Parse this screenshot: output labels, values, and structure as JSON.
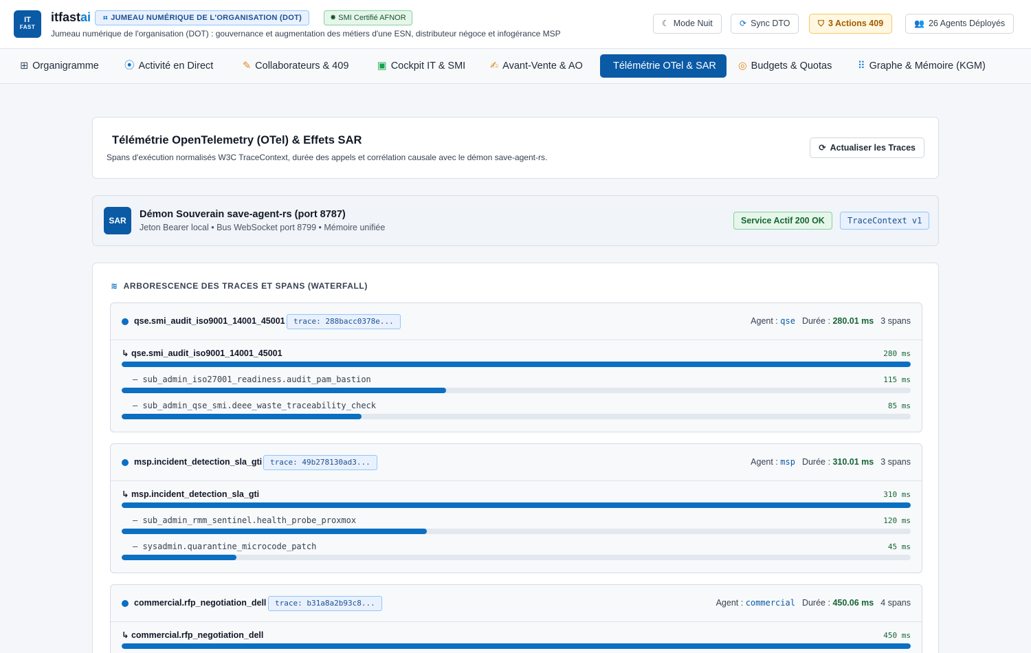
{
  "header": {
    "logo_top": "IT",
    "logo_bottom": "FAST",
    "brand": "itfast",
    "brand_suffix": "ai",
    "badge_dot": "JUMEAU NUMÉRIQUE DE L'ORGANISATION (DOT)",
    "badge_smi": "SMI Certifié AFNOR",
    "subtitle": "Jumeau numérique de l'organisation (DOT) : gouvernance et augmentation des métiers d'une ESN, distributeur négoce et infogérance MSP",
    "buttons": {
      "night": "Mode Nuit",
      "sync": "Sync DTO",
      "actions": "3 Actions 409",
      "agents": "26 Agents Déployés"
    }
  },
  "tabs": [
    {
      "label": "Organigramme",
      "icon": "sitemap-icon"
    },
    {
      "label": "Activité en Direct",
      "icon": "broadcast-icon"
    },
    {
      "label": "Collaborateurs & 409",
      "icon": "user-edit-icon"
    },
    {
      "label": "Cockpit IT & SMI",
      "icon": "briefcase-icon"
    },
    {
      "label": "Avant-Vente & AO",
      "icon": "file-signature-icon"
    },
    {
      "label": "Télémétrie OTel & SAR",
      "icon": "telemetry-icon",
      "active": true
    },
    {
      "label": "Budgets & Quotas",
      "icon": "coins-icon"
    },
    {
      "label": "Graphe & Mémoire (KGM)",
      "icon": "graph-icon"
    }
  ],
  "telemetry": {
    "title": "Télémétrie OpenTelemetry (OTel) & Effets SAR",
    "description": "Spans d'exécution normalisés W3C TraceContext, durée des appels et corrélation causale avec le démon save-agent-rs.",
    "refresh_label": "Actualiser les Traces"
  },
  "sar": {
    "logo": "SAR",
    "title": "Démon Souverain save-agent-rs (port 8787)",
    "subtitle": "Jeton Bearer local • Bus WebSocket port 8799 • Mémoire unifiée",
    "status": "Service Actif 200 OK",
    "trace_context": "TraceContext v1"
  },
  "waterfall": {
    "heading": "ARBORESCENCE DES TRACES ET SPANS (WATERFALL)",
    "agent_label": "Agent :",
    "duration_label": "Durée :",
    "traces": [
      {
        "name": "qse.smi_audit_iso9001_14001_45001",
        "trace_id": "trace: 288bacc0378e...",
        "agent": "qse",
        "duration": "280.01 ms",
        "spans_count": "3 spans",
        "total_ms": 280,
        "spans": [
          {
            "label": "↳ qse.smi_audit_iso9001_14001_45001",
            "ms": 280,
            "ms_label": "280 ms",
            "root": true
          },
          {
            "label": "– sub_admin_iso27001_readiness.audit_pam_bastion",
            "ms": 115,
            "ms_label": "115 ms"
          },
          {
            "label": "– sub_admin_qse_smi.deee_waste_traceability_check",
            "ms": 85,
            "ms_label": "85 ms"
          }
        ]
      },
      {
        "name": "msp.incident_detection_sla_gti",
        "trace_id": "trace: 49b278130ad3...",
        "agent": "msp",
        "duration": "310.01 ms",
        "spans_count": "3 spans",
        "total_ms": 310,
        "spans": [
          {
            "label": "↳ msp.incident_detection_sla_gti",
            "ms": 310,
            "ms_label": "310 ms",
            "root": true
          },
          {
            "label": "– sub_admin_rmm_sentinel.health_probe_proxmox",
            "ms": 120,
            "ms_label": "120 ms"
          },
          {
            "label": "– sysadmin.quarantine_microcode_patch",
            "ms": 45,
            "ms_label": "45 ms"
          }
        ]
      },
      {
        "name": "commercial.rfp_negotiation_dell",
        "trace_id": "trace: b31a8a2b93c8...",
        "agent": "commercial",
        "duration": "450.06 ms",
        "spans_count": "4 spans",
        "total_ms": 450,
        "spans": [
          {
            "label": "↳ commercial.rfp_negotiation_dell",
            "ms": 450,
            "ms_label": "450 ms",
            "root": true
          }
        ]
      }
    ]
  }
}
